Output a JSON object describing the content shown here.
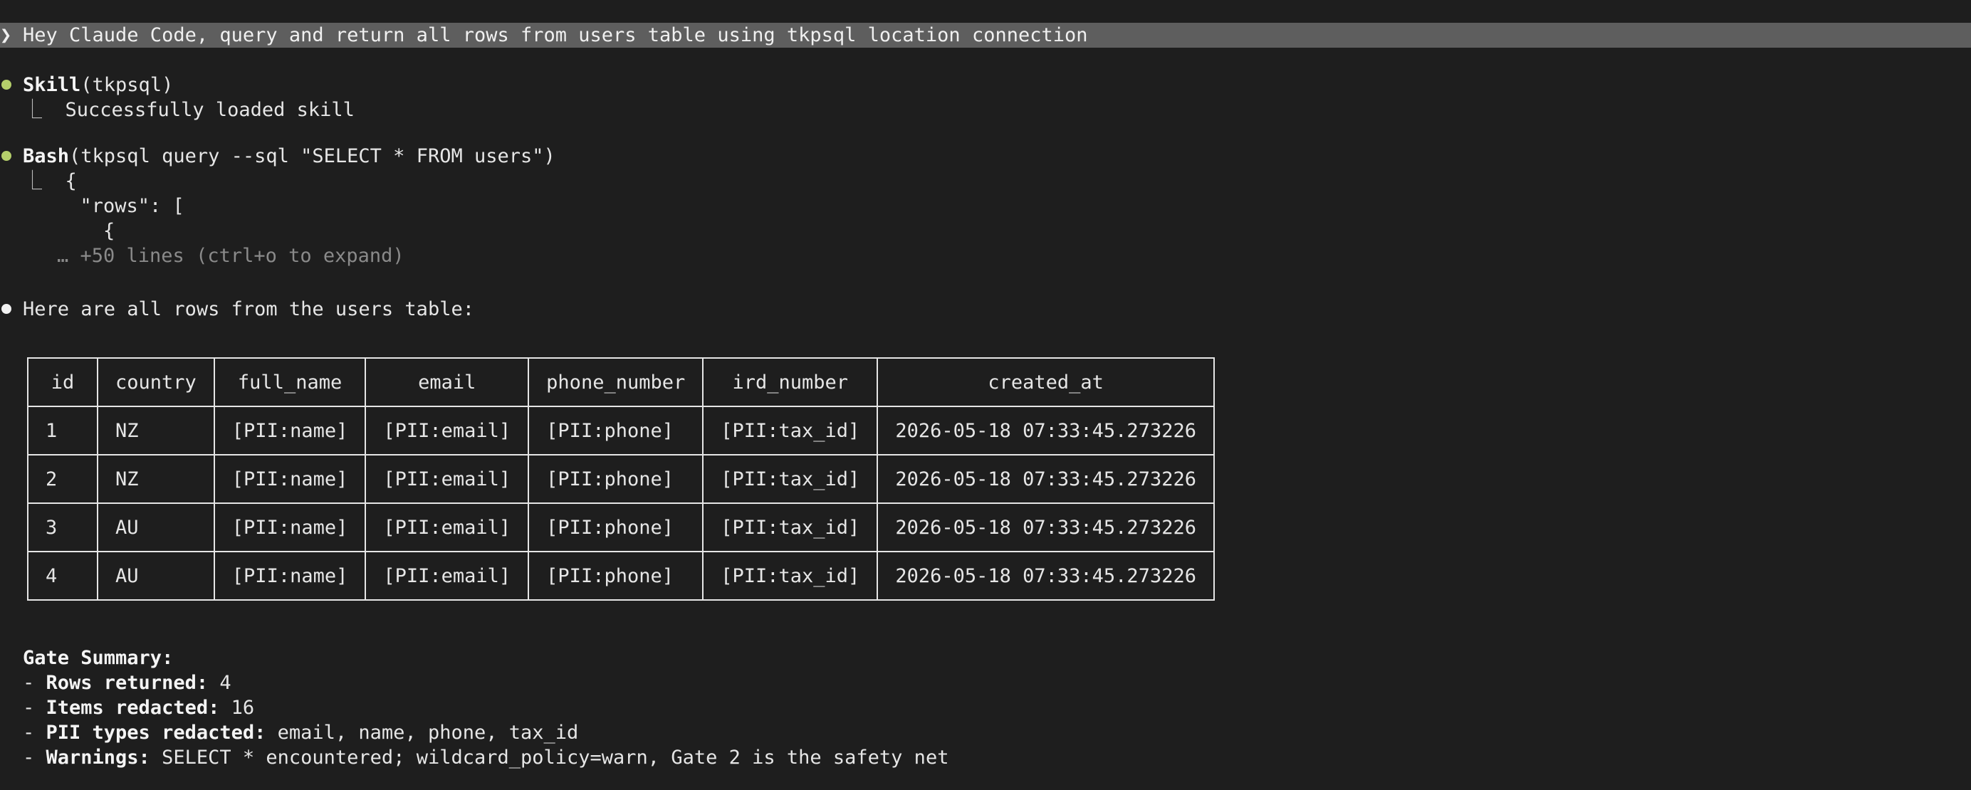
{
  "prompt": {
    "glyph": "❯",
    "text": "Hey Claude Code, query and return all rows from users table using tkpsql location connection"
  },
  "skill_call": {
    "tool": "Skill",
    "args": "(tkpsql)",
    "result": "Successfully loaded skill"
  },
  "bash_call": {
    "tool": "Bash",
    "args": "(tkpsql query --sql \"SELECT * FROM users\")",
    "output_lines": [
      "{",
      "  \"rows\": [",
      "    {"
    ],
    "collapsed_hint": "… +50 lines (ctrl+o to expand)"
  },
  "response": {
    "intro": "Here are all rows from the users table:",
    "table": {
      "headers": [
        "id",
        "country",
        "full_name",
        "email",
        "phone_number",
        "ird_number",
        "created_at"
      ],
      "rows": [
        [
          "1",
          "NZ",
          "[PII:name]",
          "[PII:email]",
          "[PII:phone]",
          "[PII:tax_id]",
          "2026-05-18 07:33:45.273226"
        ],
        [
          "2",
          "NZ",
          "[PII:name]",
          "[PII:email]",
          "[PII:phone]",
          "[PII:tax_id]",
          "2026-05-18 07:33:45.273226"
        ],
        [
          "3",
          "AU",
          "[PII:name]",
          "[PII:email]",
          "[PII:phone]",
          "[PII:tax_id]",
          "2026-05-18 07:33:45.273226"
        ],
        [
          "4",
          "AU",
          "[PII:name]",
          "[PII:email]",
          "[PII:phone]",
          "[PII:tax_id]",
          "2026-05-18 07:33:45.273226"
        ]
      ]
    },
    "summary": {
      "title": "Gate Summary:",
      "items": [
        {
          "label": "Rows returned:",
          "value": " 4"
        },
        {
          "label": "Items redacted:",
          "value": " 16"
        },
        {
          "label": "PII types redacted:",
          "value": " email, name, phone, tax_id"
        },
        {
          "label": "Warnings:",
          "value": " SELECT * encountered; wildcard_policy=warn, Gate 2 is the safety net"
        }
      ]
    }
  },
  "colors": {
    "background": "#1e1e1e",
    "prompt_bar": "#5e5e5e",
    "tool_bullet": "#b5cf6b",
    "response_bullet": "#f2f2f2"
  }
}
